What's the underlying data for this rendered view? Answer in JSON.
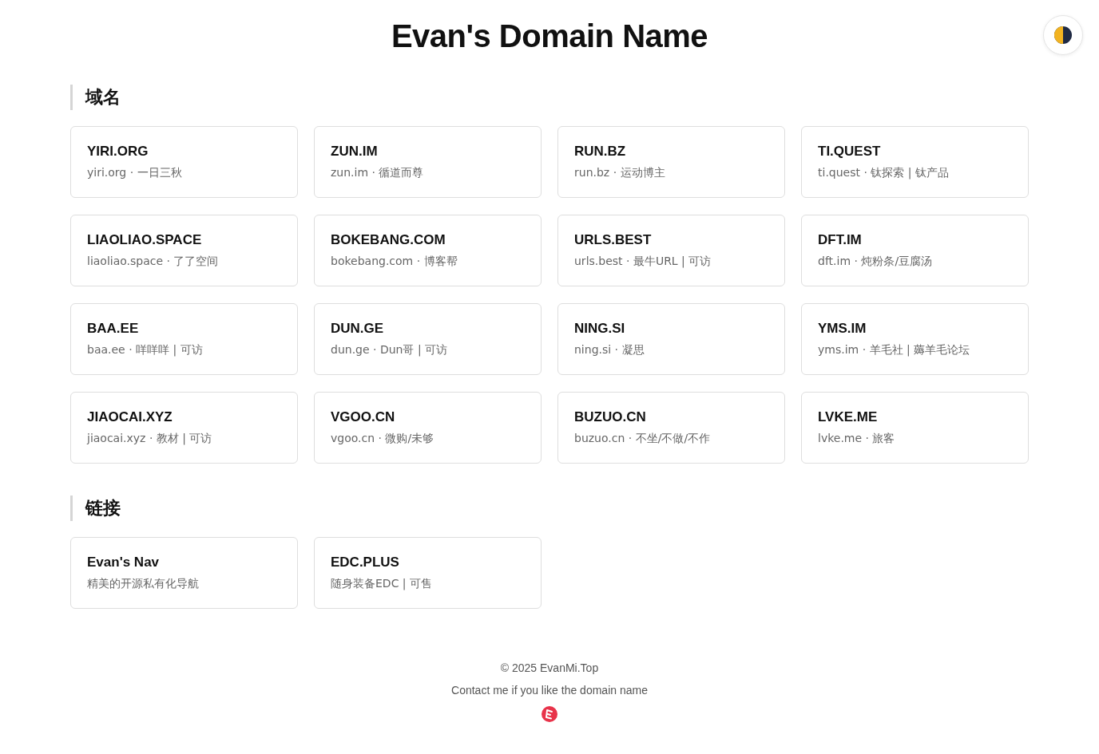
{
  "title": "Evan's Domain Name",
  "sections": [
    {
      "heading": "域名",
      "cards": [
        {
          "name": "YIRI.ORG",
          "desc": "yiri.org · 一日三秋"
        },
        {
          "name": "ZUN.IM",
          "desc": "zun.im · 循道而尊"
        },
        {
          "name": "RUN.BZ",
          "desc": "run.bz · 运动博主"
        },
        {
          "name": "TI.QUEST",
          "desc": "ti.quest · 钛探索 | 钛产品"
        },
        {
          "name": "LIAOLIAO.SPACE",
          "desc": "liaoliao.space · 了了空间"
        },
        {
          "name": "BOKEBANG.COM",
          "desc": "bokebang.com · 博客帮"
        },
        {
          "name": "URLS.BEST",
          "desc": "urls.best · 最牛URL | 可访"
        },
        {
          "name": "DFT.IM",
          "desc": "dft.im · 炖粉条/豆腐汤"
        },
        {
          "name": "BAA.EE",
          "desc": "baa.ee · 咩咩咩 | 可访"
        },
        {
          "name": "DUN.GE",
          "desc": "dun.ge · Dun哥 | 可访"
        },
        {
          "name": "NING.SI",
          "desc": "ning.si · 凝思"
        },
        {
          "name": "YMS.IM",
          "desc": "yms.im · 羊毛社 | 薅羊毛论坛"
        },
        {
          "name": "JIAOCAI.XYZ",
          "desc": "jiaocai.xyz · 教材 | 可访"
        },
        {
          "name": "VGOO.CN",
          "desc": "vgoo.cn · 微购/未够"
        },
        {
          "name": "BUZUO.CN",
          "desc": "buzuo.cn · 不坐/不做/不作"
        },
        {
          "name": "LVKE.ME",
          "desc": "lvke.me · 旅客"
        }
      ]
    },
    {
      "heading": "链接",
      "cards": [
        {
          "name": "Evan's Nav",
          "desc": "精美的开源私有化导航"
        },
        {
          "name": "EDC.PLUS",
          "desc": "随身装备EDC | 可售"
        }
      ]
    }
  ],
  "footer": {
    "copyright": "© 2025 EvanMi.Top",
    "contact": "Contact me if you like the domain name"
  }
}
